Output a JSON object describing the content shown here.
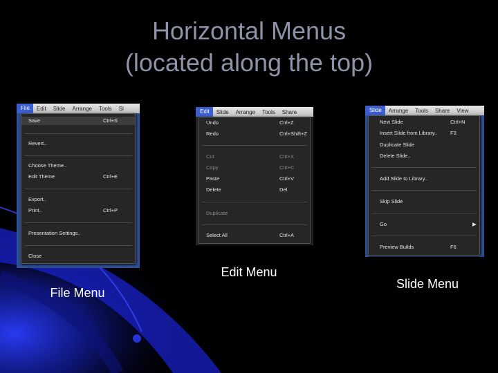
{
  "slide": {
    "title_line1": "Horizontal Menus",
    "title_line2": "(located along the top)"
  },
  "captions": {
    "file": "File Menu",
    "edit": "Edit Menu",
    "slide": "Slide Menu"
  },
  "file_shot": {
    "menubar": [
      "File",
      "Edit",
      "Slide",
      "Arrange",
      "Tools",
      "Sl"
    ],
    "items": [
      {
        "label": "Save",
        "shortcut": "Ctrl+S"
      },
      {
        "label": "Revert..",
        "shortcut": ""
      },
      {
        "label": "Choose Theme..",
        "shortcut": ""
      },
      {
        "label": "Edit Theme",
        "shortcut": "Ctrl+E"
      },
      {
        "label": "Export..",
        "shortcut": ""
      },
      {
        "label": "Print..",
        "shortcut": "Ctrl+P"
      },
      {
        "label": "Presentation Settings..",
        "shortcut": ""
      },
      {
        "label": "Close",
        "shortcut": ""
      }
    ]
  },
  "edit_shot": {
    "menubar": [
      "Edit",
      "Slide",
      "Arrange",
      "Tools",
      "Share"
    ],
    "items": [
      {
        "label": "Undo",
        "shortcut": "Ctrl+Z"
      },
      {
        "label": "Redo",
        "shortcut": "Ctrl+Shift+Z"
      },
      {
        "label": "Cut",
        "shortcut": "Ctrl+X"
      },
      {
        "label": "Copy",
        "shortcut": "Ctrl+C"
      },
      {
        "label": "Paste",
        "shortcut": "Ctrl+V"
      },
      {
        "label": "Delete",
        "shortcut": "Del"
      },
      {
        "label": "Duplicate",
        "shortcut": ""
      },
      {
        "label": "Select All",
        "shortcut": "Ctrl+A"
      }
    ]
  },
  "slide_shot": {
    "menubar": [
      "Slide",
      "Arrange",
      "Tools",
      "Share",
      "View"
    ],
    "items": [
      {
        "label": "New Slide",
        "shortcut": "Ctrl+N"
      },
      {
        "label": "Insert Slide from Library..",
        "shortcut": "F3"
      },
      {
        "label": "Duplicate Slide",
        "shortcut": ""
      },
      {
        "label": "Delete Slide..",
        "shortcut": ""
      },
      {
        "label": "Add Slide to Library..",
        "shortcut": ""
      },
      {
        "label": "Skip Slide",
        "shortcut": ""
      },
      {
        "label": "Go",
        "shortcut": "▶"
      },
      {
        "label": "Preview Builds",
        "shortcut": "F6"
      }
    ]
  },
  "colors": {
    "background": "#000000",
    "title": "#8f93a8",
    "swoosh": "#1d2fd6",
    "menu_bg": "#262626",
    "menubar_active": "#3b5fd0"
  }
}
